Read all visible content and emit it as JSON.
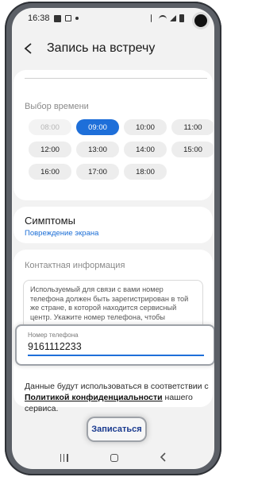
{
  "status_bar": {
    "time": "16:38"
  },
  "header": {
    "back_icon": "chevron-left-icon",
    "title": "Запись на встречу"
  },
  "time_section": {
    "label": "Выбор времени",
    "slots": [
      {
        "label": "08:00",
        "state": "disabled"
      },
      {
        "label": "09:00",
        "state": "selected"
      },
      {
        "label": "10:00",
        "state": "available"
      },
      {
        "label": "11:00",
        "state": "available"
      },
      {
        "label": "12:00",
        "state": "available"
      },
      {
        "label": "13:00",
        "state": "available"
      },
      {
        "label": "14:00",
        "state": "available"
      },
      {
        "label": "15:00",
        "state": "available"
      },
      {
        "label": "16:00",
        "state": "available"
      },
      {
        "label": "17:00",
        "state": "available"
      },
      {
        "label": "18:00",
        "state": "available"
      }
    ]
  },
  "symptoms": {
    "title": "Симптомы",
    "value": "Повреждение экрана"
  },
  "contact": {
    "label": "Контактная информация",
    "info": "Используемый для связи с вами номер телефона должен быть зарегистрирован в той же стране, в которой находится сервисный центр. Укажите номер телефона, чтобы подтвердить запись.",
    "phone_label": "Номер телефона",
    "phone_value": "9161112233"
  },
  "consent": {
    "before": "Данные будут использоваться в соответствии с ",
    "link": "Политикой конфиденциальности",
    "after": " нашего сервиса."
  },
  "book_button": "Записаться",
  "colors": {
    "accent": "#1e6fd9",
    "link": "#1b6ed6",
    "background": "#f2f2f2"
  }
}
